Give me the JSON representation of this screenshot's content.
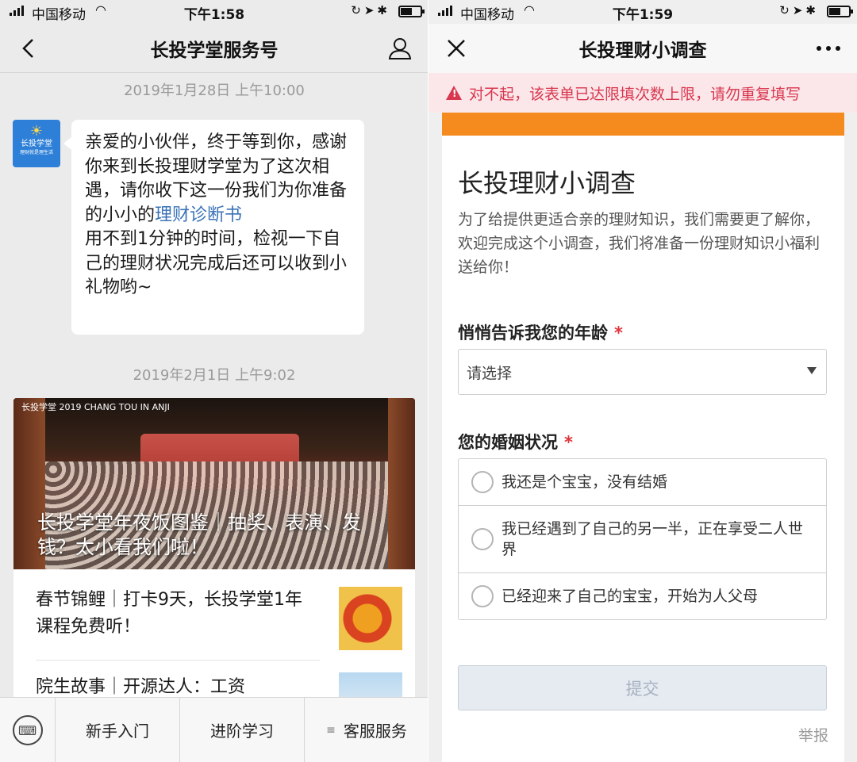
{
  "left": {
    "status": {
      "carrier": "中国移动",
      "time": "下午1:58"
    },
    "nav": {
      "title": "长投学堂服务号"
    },
    "date1": "2019年1月28日 上午10:00",
    "account": {
      "name": "长投学堂",
      "tagline": "理财就是理生活"
    },
    "message": {
      "part1": "亲爱的小伙伴，终于等到你，感谢你来到长投理财学堂为了这次相遇，请你收下这一份我们为你准备的小小的",
      "link": "理财诊断书",
      "part2": "用不到1分钟的时间，检视一下自己的理财状况完成后还可以收到小礼物哟~"
    },
    "date2": "2019年2月1日 上午9:02",
    "article": {
      "brand": "长投学堂 2019 CHANG TOU IN ANJI",
      "headline": "长投学堂年夜饭图鉴｜抽奖、表演、发钱？太小看我们啦！",
      "items": [
        {
          "title": "春节锦鲤｜打卡9天，长投学堂1年课程免费听！"
        },
        {
          "title": "院生故事｜开源达人：工资"
        }
      ]
    },
    "menu": [
      "新手入门",
      "进阶学习",
      "客服服务"
    ]
  },
  "right": {
    "status": {
      "carrier": "中国移动",
      "time": "下午1:59"
    },
    "nav": {
      "title": "长投理财小调查"
    },
    "alert": "对不起，该表单已达限填次数上限，请勿重复填写",
    "form": {
      "title": "长投理财小调查",
      "description": "为了给提供更适合亲的理财知识，我们需要更了解你，欢迎完成这个小调查，我们将准备一份理财知识小福利送给你！",
      "q1": {
        "label": "悄悄告诉我您的年龄",
        "required": "*",
        "placeholder": "请选择"
      },
      "q2": {
        "label": "您的婚姻状况",
        "required": "*",
        "options": [
          "我还是个宝宝，没有结婚",
          "我已经遇到了自己的另一半，正在享受二人世界",
          "已经迎来了自己的宝宝，开始为人父母"
        ]
      },
      "submit": "提交",
      "report": "举报"
    }
  },
  "colors": {
    "accent_orange": "#f58a1f",
    "alert_red": "#d9364f",
    "link_blue": "#3a73b8"
  }
}
